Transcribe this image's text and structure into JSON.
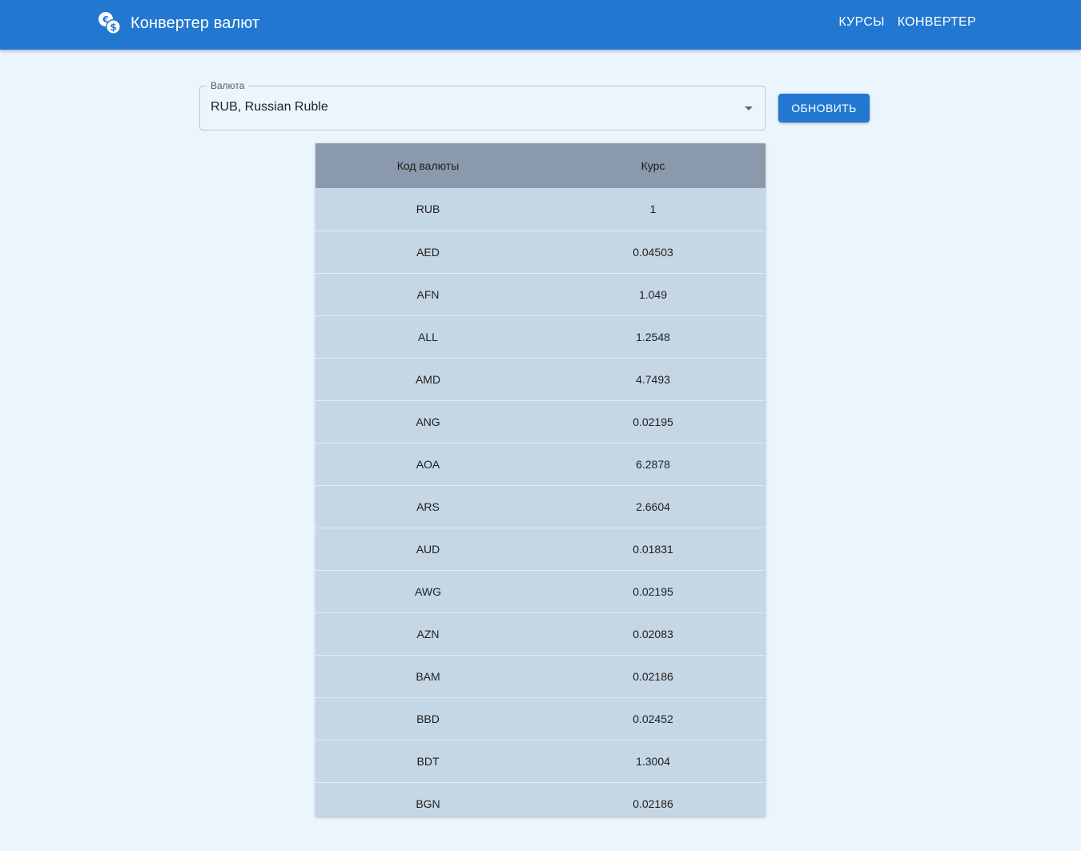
{
  "app": {
    "title": "Конвертер валют",
    "icon": "currency-exchange-icon",
    "brand_color": "#2277d1"
  },
  "nav": {
    "items": [
      {
        "label": "КУРСЫ"
      },
      {
        "label": "КОНВЕРТЕР"
      }
    ]
  },
  "currency_select": {
    "label": "Валюта",
    "value": "RUB, Russian Ruble"
  },
  "update_button": {
    "label": "ОБНОВИТЬ"
  },
  "rates_table": {
    "columns": [
      "Код валюты",
      "Курс"
    ],
    "rows": [
      {
        "code": "RUB",
        "rate": "1"
      },
      {
        "code": "AED",
        "rate": "0.04503"
      },
      {
        "code": "AFN",
        "rate": "1.049"
      },
      {
        "code": "ALL",
        "rate": "1.2548"
      },
      {
        "code": "AMD",
        "rate": "4.7493"
      },
      {
        "code": "ANG",
        "rate": "0.02195"
      },
      {
        "code": "AOA",
        "rate": "6.2878"
      },
      {
        "code": "ARS",
        "rate": "2.6604"
      },
      {
        "code": "AUD",
        "rate": "0.01831"
      },
      {
        "code": "AWG",
        "rate": "0.02195"
      },
      {
        "code": "AZN",
        "rate": "0.02083"
      },
      {
        "code": "BAM",
        "rate": "0.02186"
      },
      {
        "code": "BBD",
        "rate": "0.02452"
      },
      {
        "code": "BDT",
        "rate": "1.3004"
      },
      {
        "code": "BGN",
        "rate": "0.02186"
      }
    ]
  }
}
